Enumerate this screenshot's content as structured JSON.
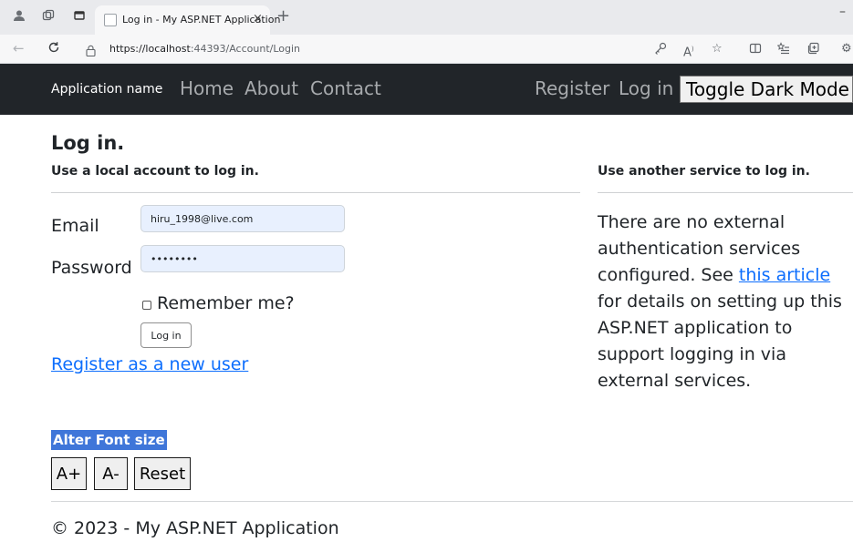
{
  "browser": {
    "tab_title": "Log in - My ASP.NET Application",
    "tab_close": "×",
    "new_tab": "+",
    "url_host": "https://localhost",
    "url_rest": ":44393/Account/Login",
    "back": "←",
    "reload": "C"
  },
  "navbar": {
    "brand": "Application name",
    "home": "Home",
    "about": "About",
    "contact": "Contact",
    "register": "Register",
    "login": "Log in",
    "dark_mode": "Toggle Dark Mode"
  },
  "login": {
    "title": "Log in.",
    "subtitle": "Use a local account to log in.",
    "email_label": "Email",
    "email_value": "hiru_1998@live.com",
    "password_label": "Password",
    "password_value": "hiru1998",
    "remember_label": "Remember me?",
    "submit_label": "Log in",
    "register_link": "Register as a new user"
  },
  "external": {
    "title": "Use another service to log in.",
    "text_before": "There are no external authentication services configured. See ",
    "link_text": "this article",
    "text_after": " for details on setting up this ASP.NET application to support logging in via external services."
  },
  "font_controls": {
    "title": "Alter Font size",
    "increase": "A+",
    "decrease": "A-",
    "reset": "Reset"
  },
  "footer": {
    "text": "© 2023 - My ASP.NET Application"
  },
  "colors": {
    "navbar_bg": "#212529",
    "link": "#0d6efd",
    "autofill_bg": "#e8f0fe",
    "highlight": "#3f76d9"
  }
}
